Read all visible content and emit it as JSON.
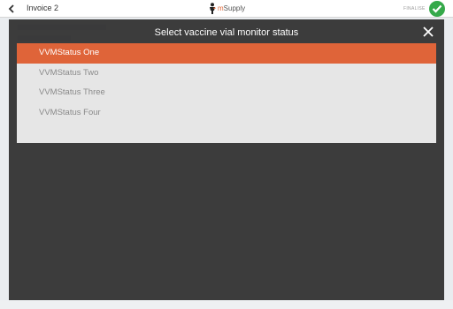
{
  "header": {
    "title": "Invoice 2",
    "brand_prefix": "m",
    "brand_name": "Supply",
    "finalise_label": "FINALISE"
  },
  "modal": {
    "title": "Select vaccine vial monitor status",
    "options": [
      {
        "label": "VVMStatus One",
        "selected": true
      },
      {
        "label": "VVMStatus Two",
        "selected": false
      },
      {
        "label": "VVMStatus Three",
        "selected": false
      },
      {
        "label": "VVMStatus Four",
        "selected": false
      }
    ]
  },
  "colors": {
    "accent": "#df6439",
    "success": "#35a94a",
    "overlay": "#303030",
    "option_background": "#e6e6e6"
  },
  "icons": {
    "back": "chevron-left-icon",
    "logo": "person-logo-icon",
    "finalise": "check-circle-icon",
    "close": "close-icon"
  }
}
